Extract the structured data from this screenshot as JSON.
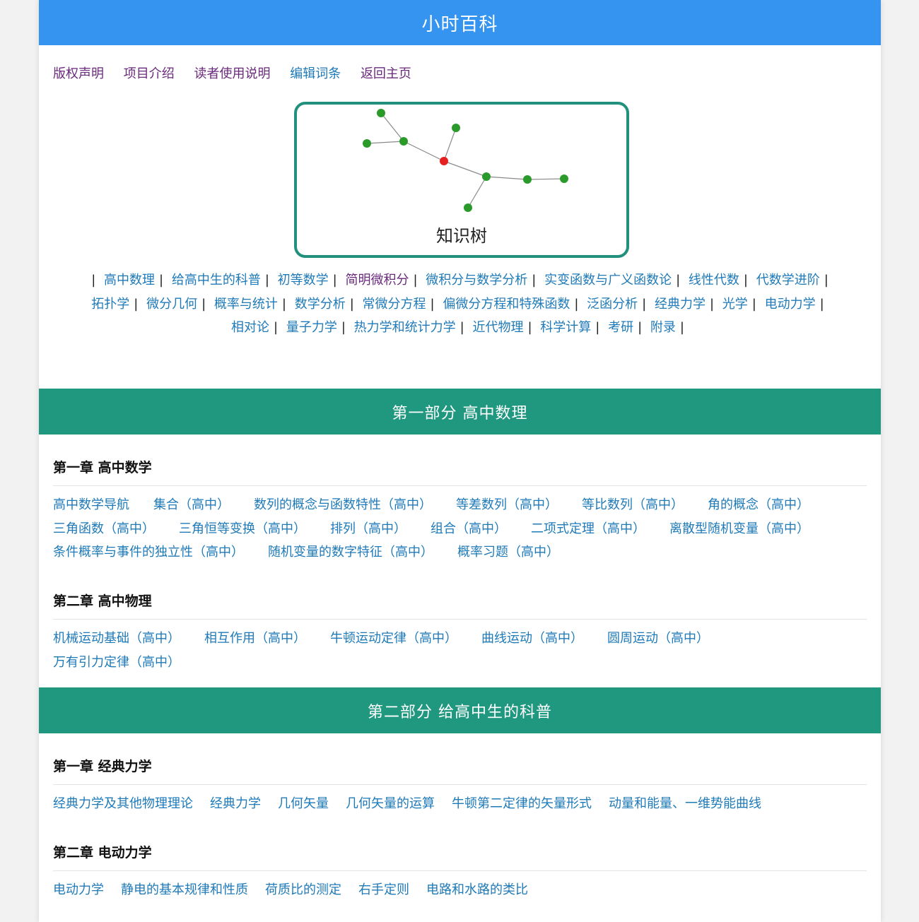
{
  "header": {
    "title": "小时百科"
  },
  "nav": [
    "版权声明",
    "项目介绍",
    "读者使用说明",
    "编辑词条",
    "返回主页"
  ],
  "tree": {
    "caption": "知识树"
  },
  "colors": {
    "header": "#3594ef",
    "band": "#20977f",
    "link": "#1f7ab8",
    "visited": "#6a2a7c",
    "node": "#2a9a2a",
    "root": "#e62020"
  },
  "subjects": [
    "高中数理",
    "给高中生的科普",
    "初等数学",
    "简明微积分",
    "微积分与数学分析",
    "实变函数与广义函数论",
    "线性代数",
    "代数学进阶",
    "拓扑学",
    "微分几何",
    "概率与统计",
    "数学分析",
    "常微分方程",
    "偏微分方程和特殊函数",
    "泛函分析",
    "经典力学",
    "光学",
    "电动力学",
    "相对论",
    "量子力学",
    "热力学和统计力学",
    "近代物理",
    "科学计算",
    "考研",
    "附录"
  ],
  "parts": [
    {
      "title": "第一部分  高中数理",
      "chapters": [
        {
          "title": "第一章  高中数学",
          "links": [
            "高中数学导航",
            "集合（高中）",
            "数列的概念与函数特性（高中）",
            "等差数列（高中）",
            "等比数列（高中）",
            "角的概念（高中）",
            "三角函数（高中）",
            "三角恒等变换（高中）",
            "排列（高中）",
            "组合（高中）",
            "二项式定理（高中）",
            "离散型随机变量（高中）",
            "条件概率与事件的独立性（高中）",
            "随机变量的数字特征（高中）",
            "概率习题（高中）"
          ]
        },
        {
          "title": "第二章  高中物理",
          "links": [
            "机械运动基础（高中）",
            "相互作用（高中）",
            "牛顿运动定律（高中）",
            "曲线运动（高中）",
            "圆周运动（高中）",
            "万有引力定律（高中）"
          ]
        }
      ]
    },
    {
      "title": "第二部分  给高中生的科普",
      "chapters": [
        {
          "title": "第一章  经典力学",
          "links": [
            "经典力学及其他物理理论",
            "经典力学",
            "几何矢量",
            "几何矢量的运算",
            "牛顿第二定律的矢量形式",
            "动量和能量、一维势能曲线"
          ]
        },
        {
          "title": "第二章  电动力学",
          "links": [
            "电动力学",
            "静电的基本规律和性质",
            "荷质比的测定",
            "右手定则",
            "电路和水路的类比"
          ]
        }
      ]
    }
  ]
}
